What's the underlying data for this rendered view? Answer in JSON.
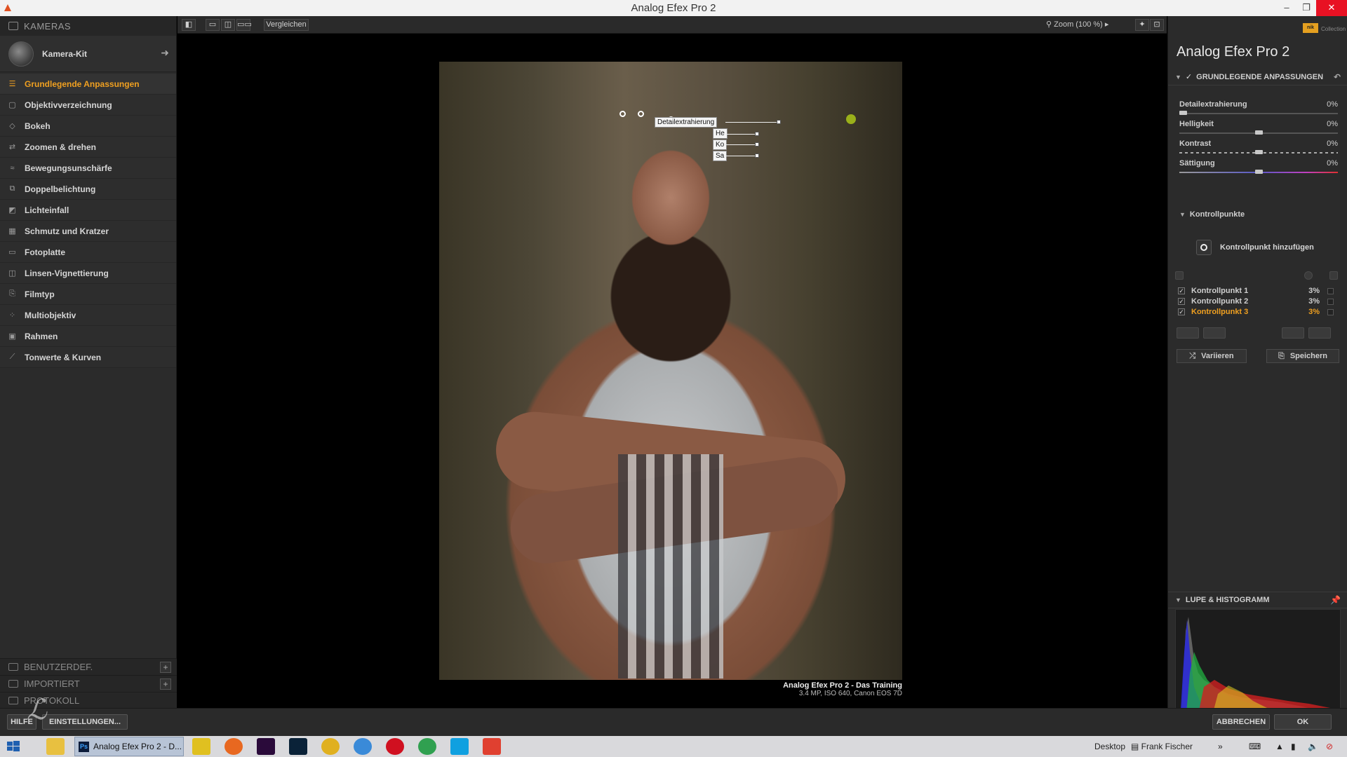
{
  "window": {
    "title": "Analog Efex Pro 2",
    "minimize": "–",
    "maximize": "❐",
    "close": "✕"
  },
  "left_panel": {
    "header": "KAMERAS",
    "camera_kit": {
      "label": "Kamera-Kit",
      "arrow": "➜"
    },
    "filters": [
      {
        "label": "Grundlegende Anpassungen",
        "icon": "sliders-icon",
        "glyph": "☰",
        "active": true
      },
      {
        "label": "Objektivverzeichnung",
        "icon": "lens-distortion-icon",
        "glyph": "▢",
        "active": false
      },
      {
        "label": "Bokeh",
        "icon": "bokeh-icon",
        "glyph": "◇",
        "active": false
      },
      {
        "label": "Zoomen & drehen",
        "icon": "zoom-rotate-icon",
        "glyph": "⇄",
        "active": false
      },
      {
        "label": "Bewegungsunschärfe",
        "icon": "motion-blur-icon",
        "glyph": "≈",
        "active": false
      },
      {
        "label": "Doppelbelichtung",
        "icon": "double-exposure-icon",
        "glyph": "⧉",
        "active": false
      },
      {
        "label": "Lichteinfall",
        "icon": "light-leak-icon",
        "glyph": "◩",
        "active": false
      },
      {
        "label": "Schmutz und Kratzer",
        "icon": "dirt-scratches-icon",
        "glyph": "▦",
        "active": false
      },
      {
        "label": "Fotoplatte",
        "icon": "photo-plate-icon",
        "glyph": "▭",
        "active": false
      },
      {
        "label": "Linsen-Vignettierung",
        "icon": "lens-vignette-icon",
        "glyph": "◫",
        "active": false
      },
      {
        "label": "Filmtyp",
        "icon": "film-type-icon",
        "glyph": "⎘",
        "active": false
      },
      {
        "label": "Multiobjektiv",
        "icon": "multi-lens-icon",
        "glyph": "⁘",
        "active": false
      },
      {
        "label": "Rahmen",
        "icon": "frame-icon",
        "glyph": "▣",
        "active": false
      },
      {
        "label": "Tonwerte & Kurven",
        "icon": "curves-icon",
        "glyph": "⟋",
        "active": false
      }
    ],
    "sections": [
      {
        "label": "BENUTZERDEF."
      },
      {
        "label": "IMPORTIERT"
      },
      {
        "label": "PROTOKOLL"
      }
    ]
  },
  "toolbar": {
    "compare_label": "Vergleichen",
    "zoom_label": "Zoom (100 %)"
  },
  "canvas": {
    "control_point_labels": [
      "Detailextrahierung",
      "He",
      "Ko",
      "Sa"
    ],
    "caption_title": "Analog Efex Pro 2 - Das Training",
    "caption_meta": "3.4 MP, ISO 640, Canon EOS 7D"
  },
  "right_panel": {
    "brand_logo": "nik",
    "brand_sub": "Collection",
    "app_title": "Analog Efex Pro 2",
    "basic_section": "GRUNDLEGENDE ANPASSUNGEN",
    "adjustments": [
      {
        "name": "Detailextrahierung",
        "value": "0%",
        "level": 0.0,
        "track": "plain"
      },
      {
        "name": "Helligkeit",
        "value": "0%",
        "level": 0.5,
        "track": "plain"
      },
      {
        "name": "Kontrast",
        "value": "0%",
        "level": 0.5,
        "track": "dashed"
      },
      {
        "name": "Sättigung",
        "value": "0%",
        "level": 0.5,
        "track": "color"
      }
    ],
    "control_points_head": "Kontrollpunkte",
    "add_control_point": "Kontrollpunkt hinzufügen",
    "control_points": [
      {
        "name": "Kontrollpunkt 1",
        "value": "3%",
        "checked": true,
        "active": false
      },
      {
        "name": "Kontrollpunkt 2",
        "value": "3%",
        "checked": true,
        "active": false
      },
      {
        "name": "Kontrollpunkt 3",
        "value": "3%",
        "checked": true,
        "active": true
      }
    ],
    "vary_label": "Variieren",
    "save_label": "Speichern",
    "histogram_section": "LUPE & HISTOGRAMM"
  },
  "bottom_bar": {
    "help_label": "HILFE",
    "settings_label": "EINSTELLUNGEN...",
    "cancel_label": "ABBRECHEN",
    "ok_label": "OK"
  },
  "taskbar": {
    "active_app_label": "Analog Efex Pro 2 - D...",
    "desktop_label": "Desktop",
    "user_label": "Frank Fischer"
  },
  "colors": {
    "accent": "#f0a020",
    "panel_bg": "#2b2b2b",
    "canvas_bg": "#000000"
  }
}
